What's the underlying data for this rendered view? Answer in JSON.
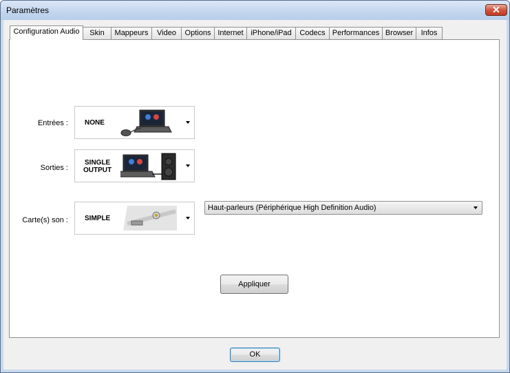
{
  "window": {
    "title": "Paramètres",
    "close_label": "✕"
  },
  "tabs": [
    {
      "label": "Configuration Audio",
      "active": true
    },
    {
      "label": "Skin"
    },
    {
      "label": "Mappeurs"
    },
    {
      "label": "Video"
    },
    {
      "label": "Options"
    },
    {
      "label": "Internet"
    },
    {
      "label": "iPhone/iPad"
    },
    {
      "label": "Codecs"
    },
    {
      "label": "Performances"
    },
    {
      "label": "Browser"
    },
    {
      "label": "Infos"
    }
  ],
  "audio": {
    "inputs": {
      "label": "Entrées :",
      "value": "NONE",
      "icon": "laptop-mouse-icon"
    },
    "outputs": {
      "label": "Sorties :",
      "value_line1": "SINGLE",
      "value_line2": "OUTPUT",
      "icon": "laptop-speaker-icon"
    },
    "soundcard": {
      "label": "Carte(s) son :",
      "value": "SIMPLE",
      "icon": "audio-jack-icon",
      "device": "Haut-parleurs (Périphérique High Definition Audio)"
    },
    "apply_label": "Appliquer"
  },
  "footer": {
    "ok_label": "OK"
  }
}
